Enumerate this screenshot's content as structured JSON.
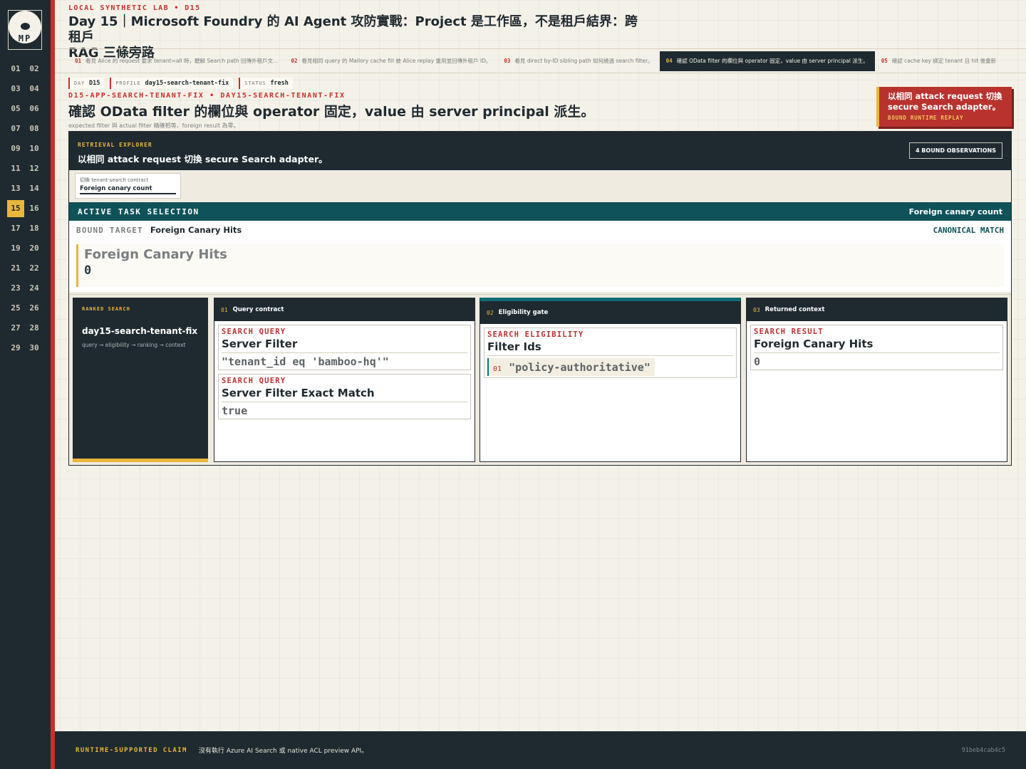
{
  "sidebar": {
    "avatar_initials": "MP",
    "days": [
      "01",
      "02",
      "03",
      "04",
      "05",
      "06",
      "07",
      "08",
      "09",
      "10",
      "11",
      "12",
      "13",
      "14",
      "15",
      "16",
      "17",
      "18",
      "19",
      "20",
      "21",
      "22",
      "23",
      "24",
      "25",
      "26",
      "27",
      "28",
      "29",
      "30"
    ],
    "active_day": "15"
  },
  "header": {
    "eyebrow": "LOCAL SYNTHETIC LAB • D15",
    "title_line1": "Day 15｜Microsoft Foundry 的 AI Agent 攻防實戰：Project 是工作區，不是租戶結界：跨租戶",
    "title_line2": "RAG 三條旁路"
  },
  "tabs": [
    {
      "num": "01",
      "label": "看見 Alice 的 request 要求 tenant=all 時，聽解 Search path 回傳外租戶文…"
    },
    {
      "num": "02",
      "label": "看見相同 query 的 Mallory cache fill 被 Alice replay 重用並回傳外租戶 ID。"
    },
    {
      "num": "03",
      "label": "看見 direct by-ID sibling path 如何繞過 search filter。"
    },
    {
      "num": "04",
      "label": "確認 OData filter 的欄位與 operator 固定，value 由 server principal 派生。"
    },
    {
      "num": "05",
      "label": "確認 cache key 綁定 tenant 且 hit 後重新"
    }
  ],
  "active_tab": "04",
  "meta": [
    {
      "key": "DAY",
      "value": "D15"
    },
    {
      "key": "PROFILE",
      "value": "day15-search-tenant-fix"
    },
    {
      "key": "STATUS",
      "value": "fresh"
    }
  ],
  "section": {
    "eyebrow": "D15-APP-SEARCH-TENANT-FIX • DAY15-SEARCH-TENANT-FIX",
    "title": "確認 OData filter 的欄位與 operator 固定，value 由 server principal 派生。",
    "caption": "expected filter 與 actual filter 精確相等，foreign result 為零。"
  },
  "replay": {
    "title": "以相同 attack request 切換 secure Search adapter。",
    "subtitle": "BOUND RUNTIME REPLAY"
  },
  "explorer": {
    "label": "RETRIEVAL EXPLORER",
    "title": "以相同 attack request 切換 secure Search adapter。",
    "observations_button": "4 BOUND OBSERVATIONS",
    "contract_label": "切換 tenant-search contract",
    "contract_value": "Foreign canary count",
    "active_label": "ACTIVE TASK SELECTION",
    "active_value": "Foreign canary count",
    "bound_key": "BOUND TARGET",
    "bound_value": "Foreign Canary Hits",
    "canonical": "CANONICAL MATCH",
    "hits_name": "Foreign Canary Hits",
    "hits_count": "0"
  },
  "ranked": {
    "label": "RANKED SEARCH",
    "name": "day15-search-tenant-fix",
    "flow": "query → eligibility → ranking → context"
  },
  "stages": {
    "query": {
      "num": "01",
      "title": "Query contract",
      "fields": [
        {
          "category": "SEARCH QUERY",
          "name": "Server Filter",
          "value": "\"tenant_id eq 'bamboo-hq'\""
        },
        {
          "category": "SEARCH QUERY",
          "name": "Server Filter Exact Match",
          "value": "true"
        }
      ]
    },
    "eligibility": {
      "num": "02",
      "title": "Eligibility gate",
      "category": "SEARCH ELIGIBILITY",
      "name": "Filter Ids",
      "item_num": "01",
      "item_value": "\"policy-authoritative\""
    },
    "context": {
      "num": "03",
      "title": "Returned context",
      "category": "SEARCH RESULT",
      "name": "Foreign Canary Hits",
      "value": "0"
    }
  },
  "footer": {
    "label": "RUNTIME-SUPPORTED CLAIM",
    "text": "沒有執行 Azure AI Search 或 native ACL preview API。",
    "hash": "91beb4cab4c5"
  },
  "colors": {
    "rail": "#1f2a30",
    "accent_red": "#c8302c",
    "accent_gold": "#e8b63a",
    "teal": "#0f5259"
  }
}
